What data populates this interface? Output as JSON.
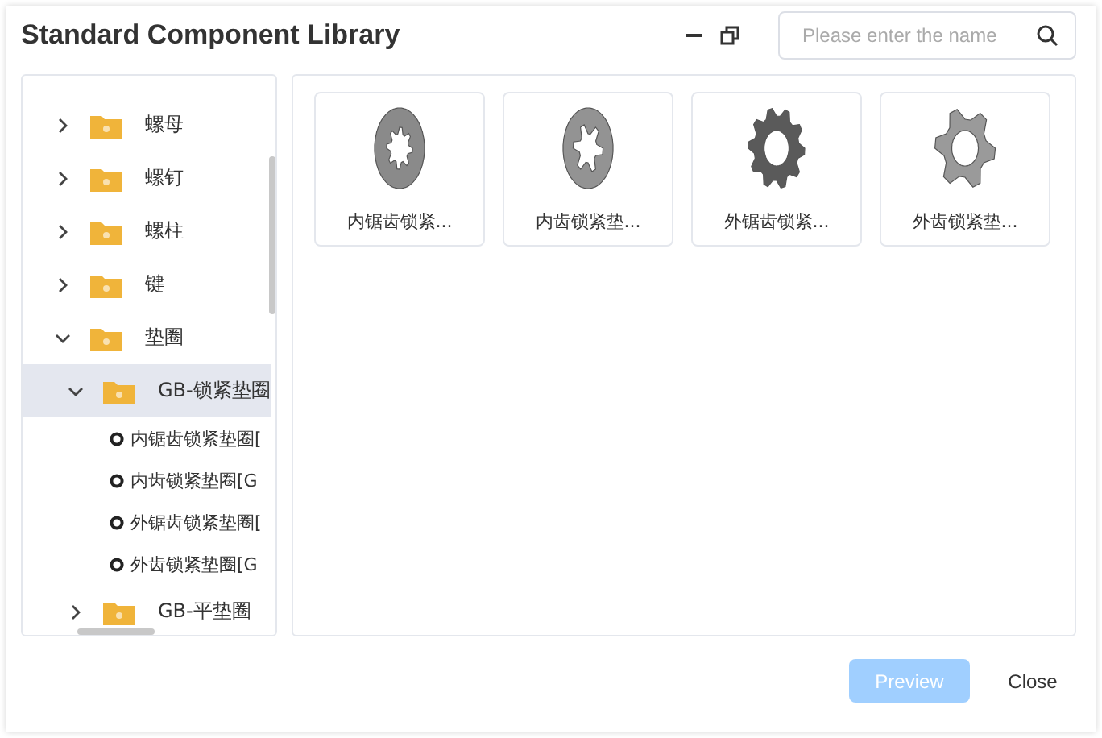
{
  "window": {
    "title": "Standard Component Library"
  },
  "search": {
    "placeholder": "Please enter the name"
  },
  "tree": [
    {
      "label": "螺母",
      "expanded": false,
      "selected": false
    },
    {
      "label": "螺钉",
      "expanded": false,
      "selected": false
    },
    {
      "label": "螺柱",
      "expanded": false,
      "selected": false
    },
    {
      "label": "键",
      "expanded": false,
      "selected": false
    },
    {
      "label": "垫圈",
      "expanded": true,
      "selected": false,
      "children": [
        {
          "label": "GB-锁紧垫圈",
          "expanded": true,
          "selected": true,
          "children": [
            {
              "label": "内锯齿锁紧垫圈[",
              "selected": false
            },
            {
              "label": "内齿锁紧垫圈[G",
              "selected": false
            },
            {
              "label": "外锯齿锁紧垫圈[",
              "selected": false
            },
            {
              "label": "外齿锁紧垫圈[G",
              "selected": false
            }
          ]
        },
        {
          "label": "GB-平垫圈",
          "expanded": false,
          "selected": false
        }
      ]
    }
  ],
  "parts": [
    {
      "label": "内锯齿锁紧...",
      "kind": "inner-serrated"
    },
    {
      "label": "内齿锁紧垫...",
      "kind": "inner-tooth"
    },
    {
      "label": "外锯齿锁紧...",
      "kind": "outer-serrated"
    },
    {
      "label": "外齿锁紧垫...",
      "kind": "outer-tooth"
    }
  ],
  "buttons": [
    {
      "label": "Preview",
      "disabled": true
    },
    {
      "label": "Close",
      "disabled": false
    }
  ]
}
